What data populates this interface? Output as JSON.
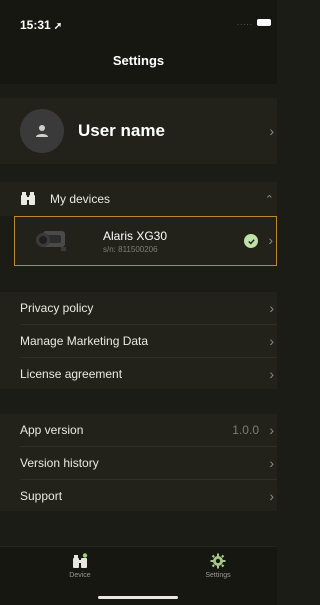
{
  "status": {
    "time": "15:31",
    "arrow": "➚",
    "dots": "....."
  },
  "header": {
    "title": "Settings"
  },
  "profile": {
    "name": "User name",
    "avatar_icon": "person-icon"
  },
  "devices": {
    "label": "My devices",
    "icon": "binoculars-icon",
    "items": [
      {
        "name": "Alaris XG30",
        "serial": "s/n: 811500206",
        "connected": true
      }
    ]
  },
  "menu_group_1": [
    {
      "label": "Privacy policy"
    },
    {
      "label": "Manage Marketing Data"
    },
    {
      "label": "License agreement"
    }
  ],
  "menu_group_2": [
    {
      "label": "App version",
      "value": "1.0.0"
    },
    {
      "label": "Version history"
    },
    {
      "label": "Support"
    }
  ],
  "tabs": [
    {
      "label": "Device",
      "icon": "binoculars-icon"
    },
    {
      "label": "Settings",
      "icon": "gear-icon"
    }
  ],
  "colors": {
    "accent": "#b8892d",
    "check": "#bfe0a6",
    "active_tab": "#a6c98a"
  }
}
